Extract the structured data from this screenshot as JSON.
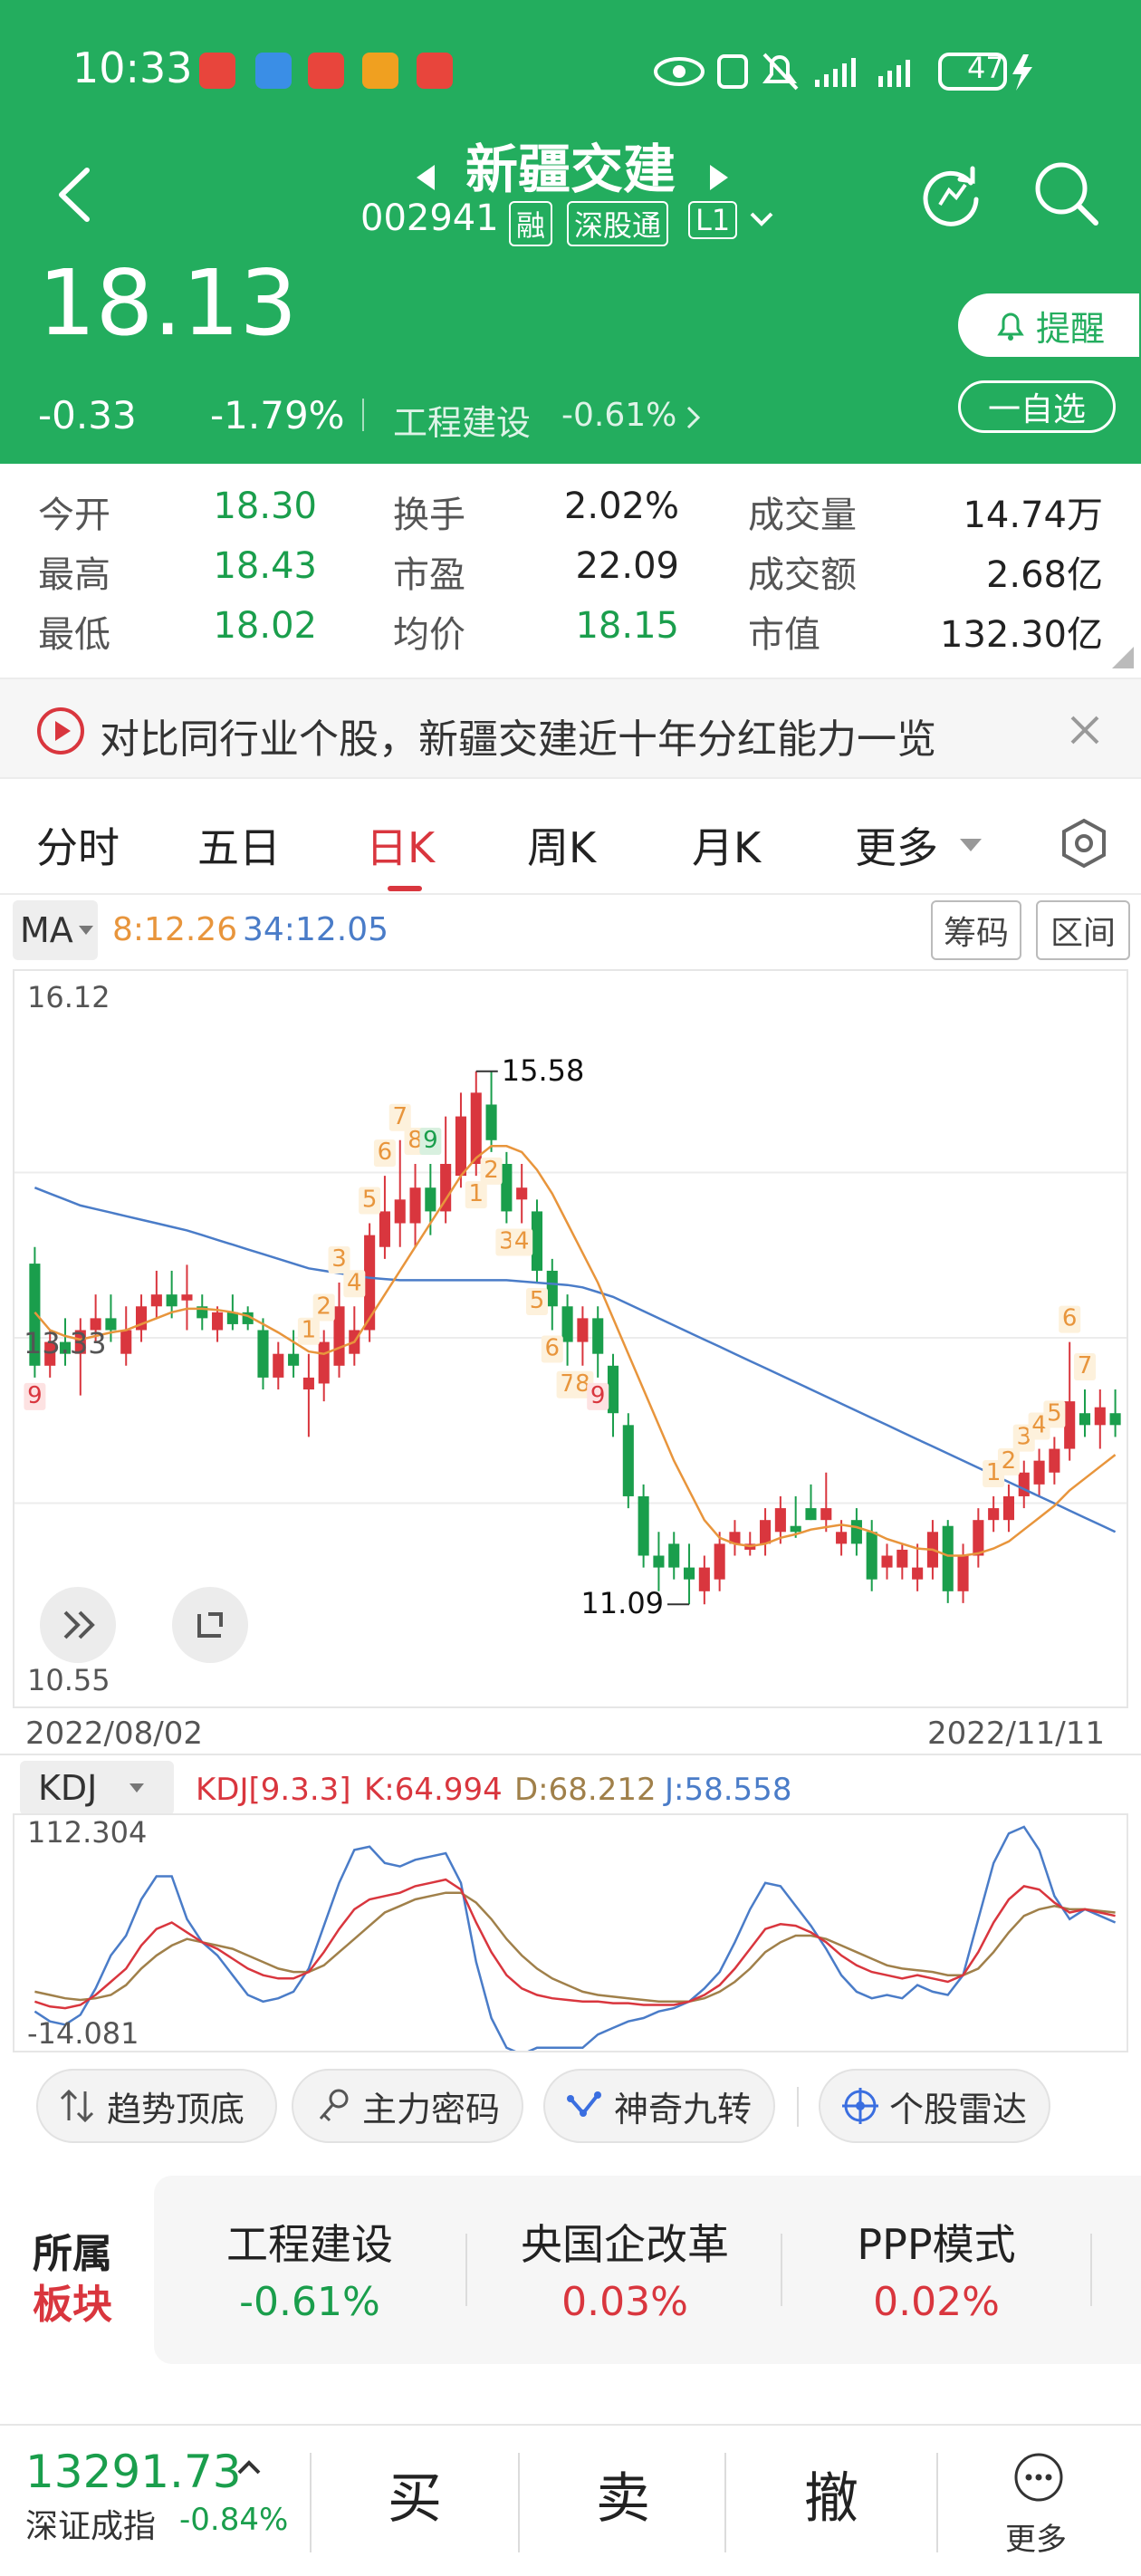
{
  "status_bar": {
    "time": "10:33",
    "battery": "47"
  },
  "stock": {
    "name": "新疆交建",
    "code": "002941",
    "tags": [
      "融",
      "深股通",
      "L1"
    ],
    "price": "18.13",
    "change": "-0.33",
    "change_pct": "-1.79%",
    "sector": "工程建设",
    "sector_pct": "-0.61%"
  },
  "buttons": {
    "alert": "提醒",
    "watchlist": "一自选"
  },
  "quote": {
    "rows": [
      [
        {
          "label": "今开",
          "value": "18.30"
        },
        {
          "label": "换手",
          "value": "2.02%"
        },
        {
          "label": "成交量",
          "value": "14.74万"
        }
      ],
      [
        {
          "label": "最高",
          "value": "18.43"
        },
        {
          "label": "市盈",
          "value": "22.09"
        },
        {
          "label": "成交额",
          "value": "2.68亿"
        }
      ],
      [
        {
          "label": "最低",
          "value": "18.02"
        },
        {
          "label": "均价",
          "value": "18.15"
        },
        {
          "label": "市值",
          "value": "132.30亿"
        }
      ]
    ]
  },
  "banner": {
    "text": "对比同行业个股，新疆交建近十年分红能力一览"
  },
  "tabs": [
    "分时",
    "五日",
    "日K",
    "周K",
    "月K",
    "更多"
  ],
  "active_tab": "日K",
  "ma_bar": {
    "label": "MA",
    "ma8": "8:12.26",
    "ma34": "34:12.05",
    "chip_btn": "筹码",
    "range_btn": "区间"
  },
  "colors": {
    "up": "#d9363e",
    "down": "#1a9e4c",
    "ma8": "#e8953c",
    "ma34": "#4a7cc8",
    "header": "#23ad5e"
  },
  "chart_data": {
    "type": "candlestick",
    "ylim": [
      10.55,
      16.12
    ],
    "y_tick_labels": [
      "16.12",
      "13.33",
      "10.55"
    ],
    "start_date": "2022/08/02",
    "end_date": "2022/11/11",
    "high_label": "15.58",
    "low_label": "11.09",
    "candles": [
      {
        "o": 13.96,
        "h": 14.1,
        "l": 13.0,
        "c": 13.1
      },
      {
        "o": 13.1,
        "h": 13.4,
        "l": 13.0,
        "c": 13.3
      },
      {
        "o": 13.3,
        "h": 13.5,
        "l": 13.1,
        "c": 13.2
      },
      {
        "o": 13.2,
        "h": 13.5,
        "l": 12.85,
        "c": 13.4
      },
      {
        "o": 13.4,
        "h": 13.7,
        "l": 13.3,
        "c": 13.5
      },
      {
        "o": 13.5,
        "h": 13.7,
        "l": 13.3,
        "c": 13.4
      },
      {
        "o": 13.2,
        "h": 13.6,
        "l": 13.1,
        "c": 13.4
      },
      {
        "o": 13.4,
        "h": 13.7,
        "l": 13.3,
        "c": 13.6
      },
      {
        "o": 13.6,
        "h": 13.9,
        "l": 13.5,
        "c": 13.7
      },
      {
        "o": 13.7,
        "h": 13.9,
        "l": 13.5,
        "c": 13.6
      },
      {
        "o": 13.65,
        "h": 13.95,
        "l": 13.4,
        "c": 13.7
      },
      {
        "o": 13.6,
        "h": 13.7,
        "l": 13.4,
        "c": 13.5
      },
      {
        "o": 13.4,
        "h": 13.6,
        "l": 13.3,
        "c": 13.55
      },
      {
        "o": 13.55,
        "h": 13.7,
        "l": 13.4,
        "c": 13.45
      },
      {
        "o": 13.55,
        "h": 13.6,
        "l": 13.4,
        "c": 13.45
      },
      {
        "o": 13.4,
        "h": 13.5,
        "l": 12.9,
        "c": 13.0
      },
      {
        "o": 13.0,
        "h": 13.3,
        "l": 12.9,
        "c": 13.2
      },
      {
        "o": 13.2,
        "h": 13.4,
        "l": 13.0,
        "c": 13.1
      },
      {
        "o": 12.9,
        "h": 13.2,
        "l": 12.5,
        "c": 13.0
      },
      {
        "o": 12.95,
        "h": 13.4,
        "l": 12.8,
        "c": 13.3
      },
      {
        "o": 13.1,
        "h": 13.8,
        "l": 13.0,
        "c": 13.6
      },
      {
        "o": 13.2,
        "h": 13.6,
        "l": 13.1,
        "c": 13.4
      },
      {
        "o": 13.4,
        "h": 14.3,
        "l": 13.3,
        "c": 14.2
      },
      {
        "o": 14.1,
        "h": 14.7,
        "l": 14.0,
        "c": 14.4
      },
      {
        "o": 14.3,
        "h": 15.0,
        "l": 14.1,
        "c": 14.5
      },
      {
        "o": 14.3,
        "h": 14.8,
        "l": 14.1,
        "c": 14.6
      },
      {
        "o": 14.6,
        "h": 14.8,
        "l": 14.2,
        "c": 14.4
      },
      {
        "o": 14.4,
        "h": 15.2,
        "l": 14.3,
        "c": 14.8
      },
      {
        "o": 14.7,
        "h": 15.4,
        "l": 14.6,
        "c": 15.2
      },
      {
        "o": 14.8,
        "h": 15.58,
        "l": 14.7,
        "c": 15.4
      },
      {
        "o": 15.3,
        "h": 15.58,
        "l": 14.9,
        "c": 15.0
      },
      {
        "o": 14.8,
        "h": 14.9,
        "l": 14.3,
        "c": 14.4
      },
      {
        "o": 14.5,
        "h": 14.8,
        "l": 14.3,
        "c": 14.6
      },
      {
        "o": 14.4,
        "h": 14.5,
        "l": 13.8,
        "c": 13.9
      },
      {
        "o": 13.9,
        "h": 14.0,
        "l": 13.4,
        "c": 13.6
      },
      {
        "o": 13.6,
        "h": 13.7,
        "l": 13.1,
        "c": 13.3
      },
      {
        "o": 13.3,
        "h": 13.6,
        "l": 13.1,
        "c": 13.5
      },
      {
        "o": 13.5,
        "h": 13.6,
        "l": 13.0,
        "c": 13.2
      },
      {
        "o": 13.1,
        "h": 13.2,
        "l": 12.5,
        "c": 12.7
      },
      {
        "o": 12.6,
        "h": 12.7,
        "l": 11.9,
        "c": 12.0
      },
      {
        "o": 12.0,
        "h": 12.1,
        "l": 11.4,
        "c": 11.5
      },
      {
        "o": 11.5,
        "h": 11.7,
        "l": 11.2,
        "c": 11.4
      },
      {
        "o": 11.6,
        "h": 11.7,
        "l": 11.3,
        "c": 11.4
      },
      {
        "o": 11.4,
        "h": 11.6,
        "l": 11.09,
        "c": 11.3
      },
      {
        "o": 11.2,
        "h": 11.5,
        "l": 11.09,
        "c": 11.4
      },
      {
        "o": 11.3,
        "h": 11.7,
        "l": 11.2,
        "c": 11.6
      },
      {
        "o": 11.6,
        "h": 11.8,
        "l": 11.5,
        "c": 11.7
      },
      {
        "o": 11.55,
        "h": 11.7,
        "l": 11.5,
        "c": 11.6
      },
      {
        "o": 11.6,
        "h": 11.9,
        "l": 11.5,
        "c": 11.8
      },
      {
        "o": 11.7,
        "h": 12.0,
        "l": 11.6,
        "c": 11.9
      },
      {
        "o": 11.75,
        "h": 12.0,
        "l": 11.65,
        "c": 11.7
      },
      {
        "o": 11.9,
        "h": 12.1,
        "l": 11.8,
        "c": 11.8
      },
      {
        "o": 11.8,
        "h": 12.2,
        "l": 11.7,
        "c": 11.9
      },
      {
        "o": 11.6,
        "h": 11.8,
        "l": 11.5,
        "c": 11.7
      },
      {
        "o": 11.8,
        "h": 11.9,
        "l": 11.5,
        "c": 11.6
      },
      {
        "o": 11.7,
        "h": 11.8,
        "l": 11.2,
        "c": 11.3
      },
      {
        "o": 11.4,
        "h": 11.6,
        "l": 11.3,
        "c": 11.5
      },
      {
        "o": 11.4,
        "h": 11.6,
        "l": 11.3,
        "c": 11.55
      },
      {
        "o": 11.3,
        "h": 11.6,
        "l": 11.2,
        "c": 11.4
      },
      {
        "o": 11.4,
        "h": 11.8,
        "l": 11.3,
        "c": 11.7
      },
      {
        "o": 11.75,
        "h": 11.8,
        "l": 11.1,
        "c": 11.2
      },
      {
        "o": 11.2,
        "h": 11.6,
        "l": 11.1,
        "c": 11.5
      },
      {
        "o": 11.5,
        "h": 11.9,
        "l": 11.4,
        "c": 11.8
      },
      {
        "o": 11.8,
        "h": 12.0,
        "l": 11.7,
        "c": 11.9
      },
      {
        "o": 11.8,
        "h": 12.1,
        "l": 11.7,
        "c": 12.0
      },
      {
        "o": 12.0,
        "h": 12.3,
        "l": 11.9,
        "c": 12.2
      },
      {
        "o": 12.1,
        "h": 12.4,
        "l": 12.0,
        "c": 12.3
      },
      {
        "o": 12.2,
        "h": 12.5,
        "l": 12.1,
        "c": 12.4
      },
      {
        "o": 12.4,
        "h": 13.3,
        "l": 12.3,
        "c": 12.8
      },
      {
        "o": 12.7,
        "h": 12.9,
        "l": 12.5,
        "c": 12.6
      },
      {
        "o": 12.6,
        "h": 12.9,
        "l": 12.4,
        "c": 12.75
      },
      {
        "o": 12.7,
        "h": 12.9,
        "l": 12.5,
        "c": 12.6
      }
    ],
    "ma8": [
      13.55,
      13.4,
      13.35,
      13.32,
      13.35,
      13.38,
      13.4,
      13.45,
      13.5,
      13.55,
      13.58,
      13.58,
      13.57,
      13.55,
      13.52,
      13.45,
      13.38,
      13.3,
      13.22,
      13.2,
      13.25,
      13.3,
      13.5,
      13.7,
      13.9,
      14.1,
      14.3,
      14.5,
      14.7,
      14.85,
      14.95,
      14.95,
      14.9,
      14.75,
      14.55,
      14.3,
      14.05,
      13.8,
      13.5,
      13.2,
      12.9,
      12.6,
      12.3,
      12.05,
      11.8,
      11.65,
      11.6,
      11.58,
      11.6,
      11.65,
      11.68,
      11.72,
      11.74,
      11.76,
      11.74,
      11.7,
      11.64,
      11.6,
      11.56,
      11.55,
      11.5,
      11.5,
      11.52,
      11.56,
      11.62,
      11.72,
      11.82,
      11.92,
      12.05,
      12.15,
      12.25,
      12.35
    ],
    "ma34": [
      14.6,
      14.55,
      14.5,
      14.45,
      14.42,
      14.39,
      14.36,
      14.33,
      14.3,
      14.27,
      14.24,
      14.2,
      14.16,
      14.12,
      14.08,
      14.04,
      14.0,
      13.96,
      13.92,
      13.9,
      13.88,
      13.86,
      13.84,
      13.83,
      13.82,
      13.82,
      13.82,
      13.82,
      13.82,
      13.82,
      13.82,
      13.82,
      13.81,
      13.8,
      13.79,
      13.78,
      13.76,
      13.72,
      13.68,
      13.62,
      13.56,
      13.5,
      13.44,
      13.38,
      13.32,
      13.26,
      13.2,
      13.14,
      13.08,
      13.02,
      12.96,
      12.9,
      12.84,
      12.78,
      12.72,
      12.66,
      12.6,
      12.54,
      12.48,
      12.42,
      12.36,
      12.3,
      12.24,
      12.18,
      12.12,
      12.06,
      12.0,
      11.94,
      11.88,
      11.82,
      11.76,
      11.7
    ],
    "nine_turn_labels": [
      {
        "i": 0,
        "t": "9",
        "up": false
      },
      {
        "i": 18,
        "t": "1",
        "up": true
      },
      {
        "i": 19,
        "t": "2",
        "up": true
      },
      {
        "i": 20,
        "t": "3",
        "up": true
      },
      {
        "i": 21,
        "t": "4",
        "up": true
      },
      {
        "i": 22,
        "t": "5",
        "up": true
      },
      {
        "i": 23,
        "t": "6",
        "up": true
      },
      {
        "i": 24,
        "t": "7",
        "up": true
      },
      {
        "i": 25,
        "t": "8",
        "up": true
      },
      {
        "i": 26,
        "t": "9",
        "up": true
      },
      {
        "i": 29,
        "t": "1",
        "up": false
      },
      {
        "i": 30,
        "t": "2",
        "up": false
      },
      {
        "i": 31,
        "t": "3",
        "up": false
      },
      {
        "i": 32,
        "t": "4",
        "up": false
      },
      {
        "i": 33,
        "t": "5",
        "up": false
      },
      {
        "i": 34,
        "t": "6",
        "up": false
      },
      {
        "i": 35,
        "t": "7",
        "up": false
      },
      {
        "i": 36,
        "t": "8",
        "up": false
      },
      {
        "i": 37,
        "t": "9",
        "up": false
      },
      {
        "i": 63,
        "t": "1",
        "up": true
      },
      {
        "i": 64,
        "t": "2",
        "up": true
      },
      {
        "i": 65,
        "t": "3",
        "up": true
      },
      {
        "i": 66,
        "t": "4",
        "up": true
      },
      {
        "i": 67,
        "t": "5",
        "up": true
      },
      {
        "i": 68,
        "t": "6",
        "up": true
      },
      {
        "i": 69,
        "t": "7",
        "up": true
      }
    ]
  },
  "kdj": {
    "label": "KDJ",
    "params": "KDJ[9.3.3]",
    "k": "K:64.994",
    "d": "D:68.212",
    "j": "J:58.558",
    "y_top": "112.304",
    "y_bottom": "-14.081",
    "ylim": [
      -14.081,
      112.304
    ],
    "K": [
      8,
      5,
      4,
      6,
      12,
      20,
      28,
      42,
      52,
      56,
      50,
      44,
      40,
      34,
      28,
      24,
      22,
      22,
      26,
      38,
      52,
      64,
      70,
      72,
      74,
      78,
      80,
      82,
      76,
      56,
      38,
      24,
      16,
      12,
      10,
      9,
      8,
      8,
      7,
      7,
      6,
      6,
      6,
      8,
      12,
      18,
      28,
      40,
      52,
      55,
      54,
      50,
      44,
      36,
      30,
      26,
      24,
      22,
      24,
      22,
      20,
      24,
      38,
      56,
      70,
      78,
      76,
      68,
      62,
      64,
      62,
      60
    ],
    "D": [
      14,
      12,
      10,
      9,
      10,
      12,
      18,
      28,
      36,
      42,
      46,
      44,
      42,
      40,
      36,
      32,
      28,
      26,
      26,
      30,
      38,
      46,
      54,
      62,
      66,
      70,
      72,
      74,
      74,
      68,
      58,
      46,
      36,
      28,
      22,
      18,
      14,
      12,
      11,
      10,
      9,
      8,
      8,
      8,
      10,
      14,
      20,
      28,
      38,
      44,
      48,
      48,
      46,
      42,
      38,
      34,
      30,
      28,
      27,
      26,
      24,
      24,
      28,
      38,
      50,
      60,
      64,
      66,
      64,
      64,
      63,
      62
    ],
    "J": [
      2,
      -4,
      -6,
      0,
      16,
      36,
      48,
      70,
      84,
      84,
      58,
      44,
      36,
      24,
      12,
      8,
      10,
      14,
      28,
      54,
      80,
      100,
      102,
      92,
      90,
      94,
      96,
      98,
      80,
      32,
      -2,
      -20,
      -24,
      -20,
      -20,
      -20,
      -20,
      -12,
      -8,
      -4,
      -2,
      2,
      4,
      8,
      16,
      26,
      44,
      64,
      80,
      78,
      66,
      54,
      40,
      24,
      14,
      10,
      12,
      10,
      18,
      14,
      12,
      24,
      58,
      92,
      110,
      114,
      100,
      72,
      58,
      64,
      60,
      56
    ]
  },
  "tools": [
    "趋势顶底",
    "主力密码",
    "神奇九转",
    "个股雷达"
  ],
  "sectors": {
    "title_line1": "所属",
    "title_line2": "板块",
    "items": [
      {
        "name": "工程建设",
        "pct": "-0.61%",
        "up": false
      },
      {
        "name": "央国企改革",
        "pct": "0.03%",
        "up": true
      },
      {
        "name": "PPP模式",
        "pct": "0.02%",
        "up": true
      }
    ]
  },
  "index": {
    "value": "13291.73",
    "name": "深证成指",
    "pct": "-0.84%"
  },
  "bottom_actions": {
    "buy": "买",
    "sell": "卖",
    "cancel": "撤",
    "more": "更多"
  }
}
